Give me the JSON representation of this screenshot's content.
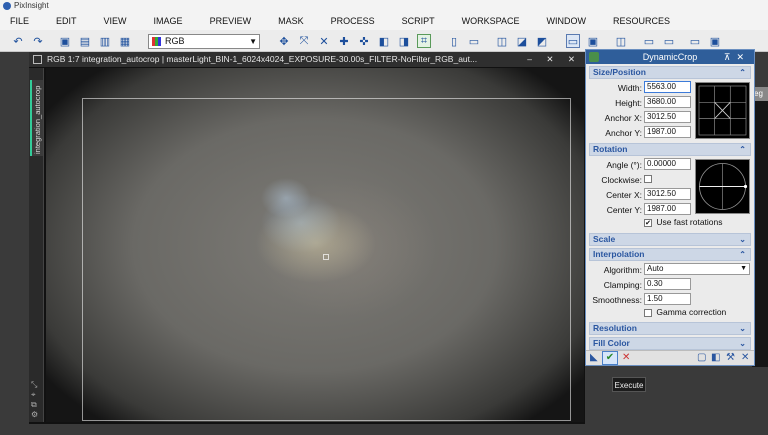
{
  "app": {
    "title": "PixInsight"
  },
  "menu": [
    "FILE",
    "EDIT",
    "VIEW",
    "IMAGE",
    "PREVIEW",
    "MASK",
    "PROCESS",
    "SCRIPT",
    "WORKSPACE",
    "WINDOW",
    "RESOURCES"
  ],
  "toolbar": {
    "color_mode": "RGB"
  },
  "image_window": {
    "title": "RGB 1:7 integration_autocrop | masterLight_BIN-1_6024x4024_EXPOSURE-30.00s_FILTER-NoFilter_RGB_aut...",
    "side_tab": "integration_autocrop",
    "controls": "– ✕ ✕"
  },
  "panel": {
    "title": "DynamicCrop",
    "size_position": {
      "header": "Size/Position",
      "width_label": "Width:",
      "width": "5563.00",
      "height_label": "Height:",
      "height": "3680.00",
      "anchor_x_label": "Anchor X:",
      "anchor_x": "3012.50",
      "anchor_y_label": "Anchor Y:",
      "anchor_y": "1987.00"
    },
    "rotation": {
      "header": "Rotation",
      "angle_label": "Angle (°):",
      "angle": "0.00000",
      "clockwise_label": "Clockwise:",
      "center_x_label": "Center X:",
      "center_x": "3012.50",
      "center_y_label": "Center Y:",
      "center_y": "1987.00",
      "fast_rotations_label": "Use fast rotations",
      "fast_rotations": true
    },
    "scale": {
      "header": "Scale"
    },
    "interpolation": {
      "header": "Interpolation",
      "algorithm_label": "Algorithm:",
      "algorithm": "Auto",
      "clamping_label": "Clamping:",
      "clamping": "0.30",
      "smoothness_label": "Smoothness:",
      "smoothness": "1.50",
      "gamma_label": "Gamma correction",
      "gamma": false
    },
    "resolution": {
      "header": "Resolution"
    },
    "fill_color": {
      "header": "Fill Color"
    }
  },
  "tooltip": "Execute",
  "colors": {
    "panel_title": "#2f5e9a",
    "section_text": "#2a56a0",
    "accent_green": "#2a8a2a"
  }
}
